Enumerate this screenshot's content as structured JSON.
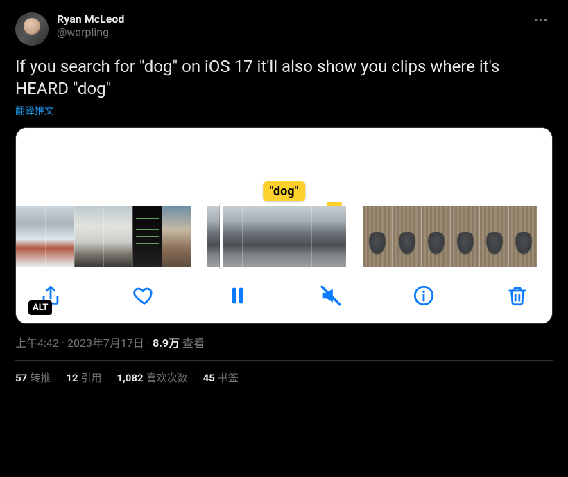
{
  "author": {
    "display_name": "Ryan McLeod",
    "handle": "@warpling"
  },
  "tweet_text": "If you search for \"dog\" on iOS 17 it'll also show you clips where it's HEARD \"dog\"",
  "translate_label": "翻译推文",
  "media": {
    "tag_text": "\"dog\"",
    "alt_badge": "ALT",
    "toolbar": {
      "share": "share-icon",
      "like": "heart-icon",
      "pause": "pause-icon",
      "mute": "mute-icon",
      "info": "info-icon",
      "trash": "trash-icon"
    }
  },
  "meta": {
    "time": "上午4:42",
    "sep1": " · ",
    "date": "2023年7月17日",
    "sep2": " · ",
    "views_count": "8.9万",
    "views_label": " 查看"
  },
  "stats": {
    "retweets": {
      "count": "57",
      "label": "转推"
    },
    "quotes": {
      "count": "12",
      "label": "引用"
    },
    "likes": {
      "count": "1,082",
      "label": "喜欢次数"
    },
    "bookmarks": {
      "count": "45",
      "label": "书签"
    }
  }
}
